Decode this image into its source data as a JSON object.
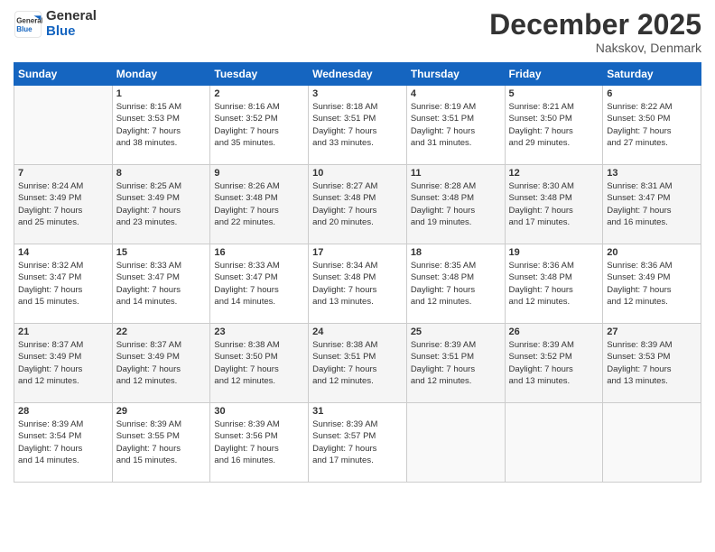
{
  "logo": {
    "line1": "General",
    "line2": "Blue"
  },
  "header": {
    "month": "December 2025",
    "location": "Nakskov, Denmark"
  },
  "days_header": [
    "Sunday",
    "Monday",
    "Tuesday",
    "Wednesday",
    "Thursday",
    "Friday",
    "Saturday"
  ],
  "weeks": [
    [
      {
        "num": "",
        "info": ""
      },
      {
        "num": "1",
        "info": "Sunrise: 8:15 AM\nSunset: 3:53 PM\nDaylight: 7 hours\nand 38 minutes."
      },
      {
        "num": "2",
        "info": "Sunrise: 8:16 AM\nSunset: 3:52 PM\nDaylight: 7 hours\nand 35 minutes."
      },
      {
        "num": "3",
        "info": "Sunrise: 8:18 AM\nSunset: 3:51 PM\nDaylight: 7 hours\nand 33 minutes."
      },
      {
        "num": "4",
        "info": "Sunrise: 8:19 AM\nSunset: 3:51 PM\nDaylight: 7 hours\nand 31 minutes."
      },
      {
        "num": "5",
        "info": "Sunrise: 8:21 AM\nSunset: 3:50 PM\nDaylight: 7 hours\nand 29 minutes."
      },
      {
        "num": "6",
        "info": "Sunrise: 8:22 AM\nSunset: 3:50 PM\nDaylight: 7 hours\nand 27 minutes."
      }
    ],
    [
      {
        "num": "7",
        "info": "Sunrise: 8:24 AM\nSunset: 3:49 PM\nDaylight: 7 hours\nand 25 minutes."
      },
      {
        "num": "8",
        "info": "Sunrise: 8:25 AM\nSunset: 3:49 PM\nDaylight: 7 hours\nand 23 minutes."
      },
      {
        "num": "9",
        "info": "Sunrise: 8:26 AM\nSunset: 3:48 PM\nDaylight: 7 hours\nand 22 minutes."
      },
      {
        "num": "10",
        "info": "Sunrise: 8:27 AM\nSunset: 3:48 PM\nDaylight: 7 hours\nand 20 minutes."
      },
      {
        "num": "11",
        "info": "Sunrise: 8:28 AM\nSunset: 3:48 PM\nDaylight: 7 hours\nand 19 minutes."
      },
      {
        "num": "12",
        "info": "Sunrise: 8:30 AM\nSunset: 3:48 PM\nDaylight: 7 hours\nand 17 minutes."
      },
      {
        "num": "13",
        "info": "Sunrise: 8:31 AM\nSunset: 3:47 PM\nDaylight: 7 hours\nand 16 minutes."
      }
    ],
    [
      {
        "num": "14",
        "info": "Sunrise: 8:32 AM\nSunset: 3:47 PM\nDaylight: 7 hours\nand 15 minutes."
      },
      {
        "num": "15",
        "info": "Sunrise: 8:33 AM\nSunset: 3:47 PM\nDaylight: 7 hours\nand 14 minutes."
      },
      {
        "num": "16",
        "info": "Sunrise: 8:33 AM\nSunset: 3:47 PM\nDaylight: 7 hours\nand 14 minutes."
      },
      {
        "num": "17",
        "info": "Sunrise: 8:34 AM\nSunset: 3:48 PM\nDaylight: 7 hours\nand 13 minutes."
      },
      {
        "num": "18",
        "info": "Sunrise: 8:35 AM\nSunset: 3:48 PM\nDaylight: 7 hours\nand 12 minutes."
      },
      {
        "num": "19",
        "info": "Sunrise: 8:36 AM\nSunset: 3:48 PM\nDaylight: 7 hours\nand 12 minutes."
      },
      {
        "num": "20",
        "info": "Sunrise: 8:36 AM\nSunset: 3:49 PM\nDaylight: 7 hours\nand 12 minutes."
      }
    ],
    [
      {
        "num": "21",
        "info": "Sunrise: 8:37 AM\nSunset: 3:49 PM\nDaylight: 7 hours\nand 12 minutes."
      },
      {
        "num": "22",
        "info": "Sunrise: 8:37 AM\nSunset: 3:49 PM\nDaylight: 7 hours\nand 12 minutes."
      },
      {
        "num": "23",
        "info": "Sunrise: 8:38 AM\nSunset: 3:50 PM\nDaylight: 7 hours\nand 12 minutes."
      },
      {
        "num": "24",
        "info": "Sunrise: 8:38 AM\nSunset: 3:51 PM\nDaylight: 7 hours\nand 12 minutes."
      },
      {
        "num": "25",
        "info": "Sunrise: 8:39 AM\nSunset: 3:51 PM\nDaylight: 7 hours\nand 12 minutes."
      },
      {
        "num": "26",
        "info": "Sunrise: 8:39 AM\nSunset: 3:52 PM\nDaylight: 7 hours\nand 13 minutes."
      },
      {
        "num": "27",
        "info": "Sunrise: 8:39 AM\nSunset: 3:53 PM\nDaylight: 7 hours\nand 13 minutes."
      }
    ],
    [
      {
        "num": "28",
        "info": "Sunrise: 8:39 AM\nSunset: 3:54 PM\nDaylight: 7 hours\nand 14 minutes."
      },
      {
        "num": "29",
        "info": "Sunrise: 8:39 AM\nSunset: 3:55 PM\nDaylight: 7 hours\nand 15 minutes."
      },
      {
        "num": "30",
        "info": "Sunrise: 8:39 AM\nSunset: 3:56 PM\nDaylight: 7 hours\nand 16 minutes."
      },
      {
        "num": "31",
        "info": "Sunrise: 8:39 AM\nSunset: 3:57 PM\nDaylight: 7 hours\nand 17 minutes."
      },
      {
        "num": "",
        "info": ""
      },
      {
        "num": "",
        "info": ""
      },
      {
        "num": "",
        "info": ""
      }
    ]
  ]
}
